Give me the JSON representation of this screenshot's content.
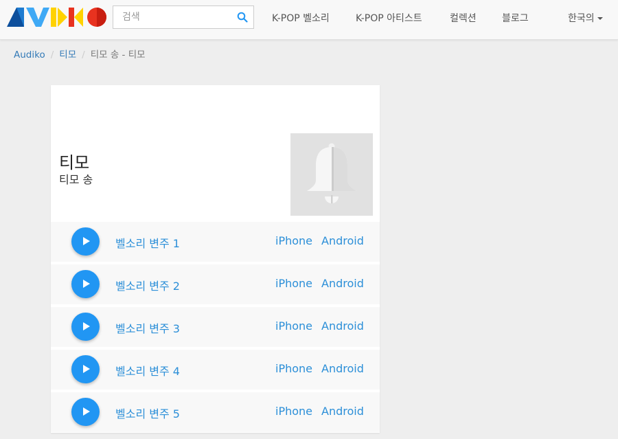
{
  "header": {
    "search_placeholder": "검색",
    "nav": [
      {
        "label": "K-POP 벨소리"
      },
      {
        "label": "K-POP 아티스트"
      },
      {
        "label": "컬렉션"
      },
      {
        "label": "블로그"
      }
    ],
    "language": "한국의"
  },
  "breadcrumb": [
    "Audiko",
    "티모",
    "티모 송 - 티모"
  ],
  "card": {
    "title": "티모",
    "subtitle": "티모 송"
  },
  "ringtones": [
    {
      "title": "벨소리 변주 1",
      "iphone": "iPhone",
      "android": "Android"
    },
    {
      "title": "벨소리 변주 2",
      "iphone": "iPhone",
      "android": "Android"
    },
    {
      "title": "벨소리 변주 3",
      "iphone": "iPhone",
      "android": "Android"
    },
    {
      "title": "벨소리 변주 4",
      "iphone": "iPhone",
      "android": "Android"
    },
    {
      "title": "벨소리 변주 5",
      "iphone": "iPhone",
      "android": "Android"
    }
  ],
  "colors": {
    "accent": "#2196f3",
    "link": "#2c8fd8",
    "logo_blue": "#0d4f9c",
    "logo_light_blue": "#3fa9f5",
    "logo_yellow": "#ffd200",
    "logo_red": "#e8321f"
  },
  "icons": {
    "search": "search-icon",
    "play": "play-icon",
    "bell": "bell-icon",
    "caret": "caret-down-icon"
  }
}
